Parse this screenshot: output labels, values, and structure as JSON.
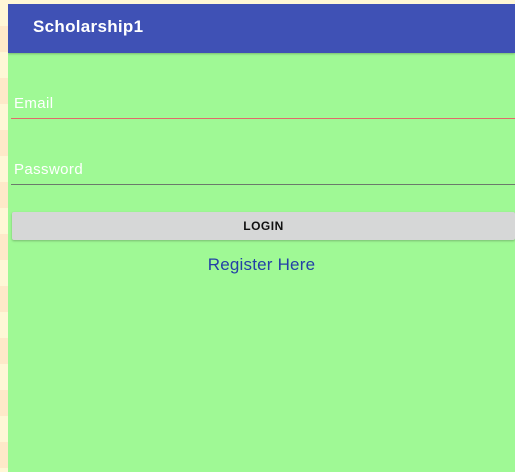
{
  "app_bar": {
    "title": "Scholarship1",
    "color": "#3f51b5"
  },
  "form": {
    "email": {
      "value": "",
      "placeholder": "Email"
    },
    "password": {
      "value": "",
      "placeholder": "Password"
    },
    "login_label": "LOGIN",
    "register_label": "Register Here"
  },
  "colors": {
    "screen_background": "#9ff995",
    "register_link": "#2340a6",
    "email_underline_focused": "#e26a6a",
    "login_button": "#d6d7d7"
  }
}
